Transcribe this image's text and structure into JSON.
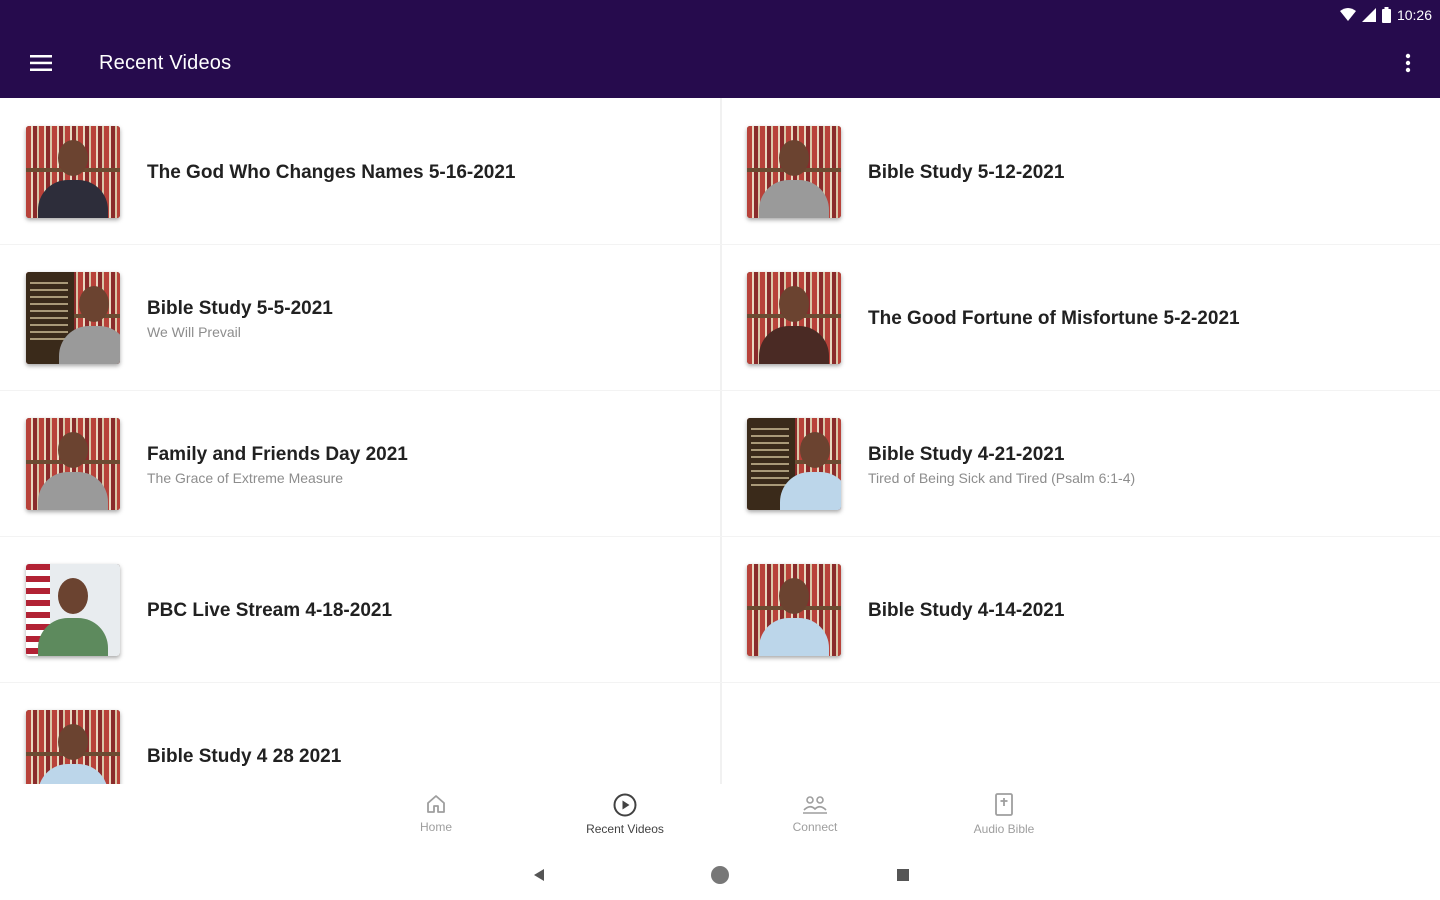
{
  "status_bar": {
    "time": "10:26"
  },
  "app_bar": {
    "title": "Recent Videos",
    "menu_icon": "hamburger-menu-icon",
    "overflow_icon": "more-vert-icon",
    "color": "#260b4d"
  },
  "videos": [
    {
      "title": "The God Who Changes Names 5-16-2021",
      "subtitle": ""
    },
    {
      "title": "Bible Study 5-12-2021",
      "subtitle": ""
    },
    {
      "title": "Bible Study 5-5-2021",
      "subtitle": "We Will Prevail"
    },
    {
      "title": "The Good Fortune of Misfortune 5-2-2021",
      "subtitle": ""
    },
    {
      "title": "Family and Friends Day 2021",
      "subtitle": "The Grace of Extreme Measure"
    },
    {
      "title": "Bible Study 4-21-2021",
      "subtitle": "Tired of Being Sick and Tired (Psalm 6:1-4)"
    },
    {
      "title": "PBC Live Stream 4-18-2021",
      "subtitle": ""
    },
    {
      "title": "Bible Study 4-14-2021",
      "subtitle": ""
    },
    {
      "title": "Bible Study 4 28 2021",
      "subtitle": ""
    }
  ],
  "bottom_nav": [
    {
      "label": "Home",
      "icon": "home-icon",
      "active": false
    },
    {
      "label": "Recent Videos",
      "icon": "play-circle-icon",
      "active": true
    },
    {
      "label": "Connect",
      "icon": "people-icon",
      "active": false
    },
    {
      "label": "Audio Bible",
      "icon": "book-icon",
      "active": false
    }
  ],
  "system_nav": {
    "back": "back-icon",
    "home": "home-circle-icon",
    "recents": "recents-square-icon"
  }
}
